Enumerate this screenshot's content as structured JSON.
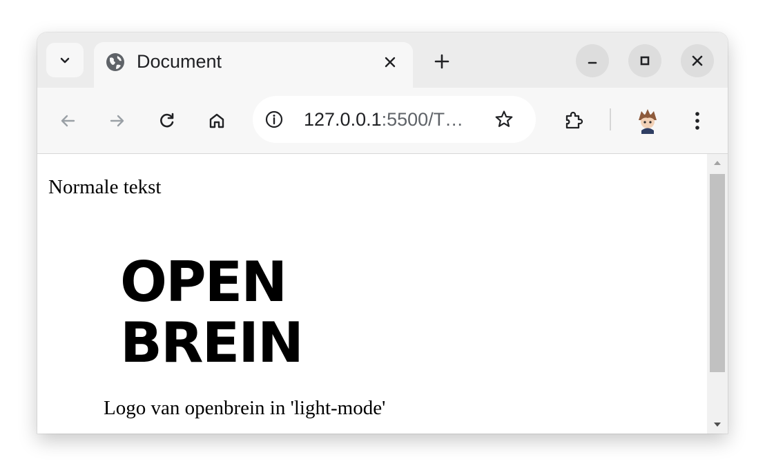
{
  "browser": {
    "tab": {
      "title": "Document",
      "favicon": "globe-icon"
    },
    "toolbar": {
      "url_host": "127.0.0.1",
      "url_rest": ":5500/T…",
      "icons": [
        "back-arrow-icon",
        "forward-arrow-icon",
        "reload-icon",
        "home-icon",
        "info-icon",
        "star-icon",
        "extensions-icon",
        "profile-avatar",
        "more-menu-icon"
      ]
    },
    "window_controls": [
      "minimize-icon",
      "maximize-icon",
      "close-icon"
    ]
  },
  "page": {
    "normal_text": "Normale tekst",
    "logo": {
      "line1": "OPEN",
      "line2": "BREIN"
    },
    "caption": "Logo van openbrein in 'light-mode'"
  },
  "colors": {
    "tabstrip": "#ececec",
    "toolbar": "#f7f7f7",
    "text": "#202124",
    "scrollbar_thumb": "#c1c1c1"
  }
}
